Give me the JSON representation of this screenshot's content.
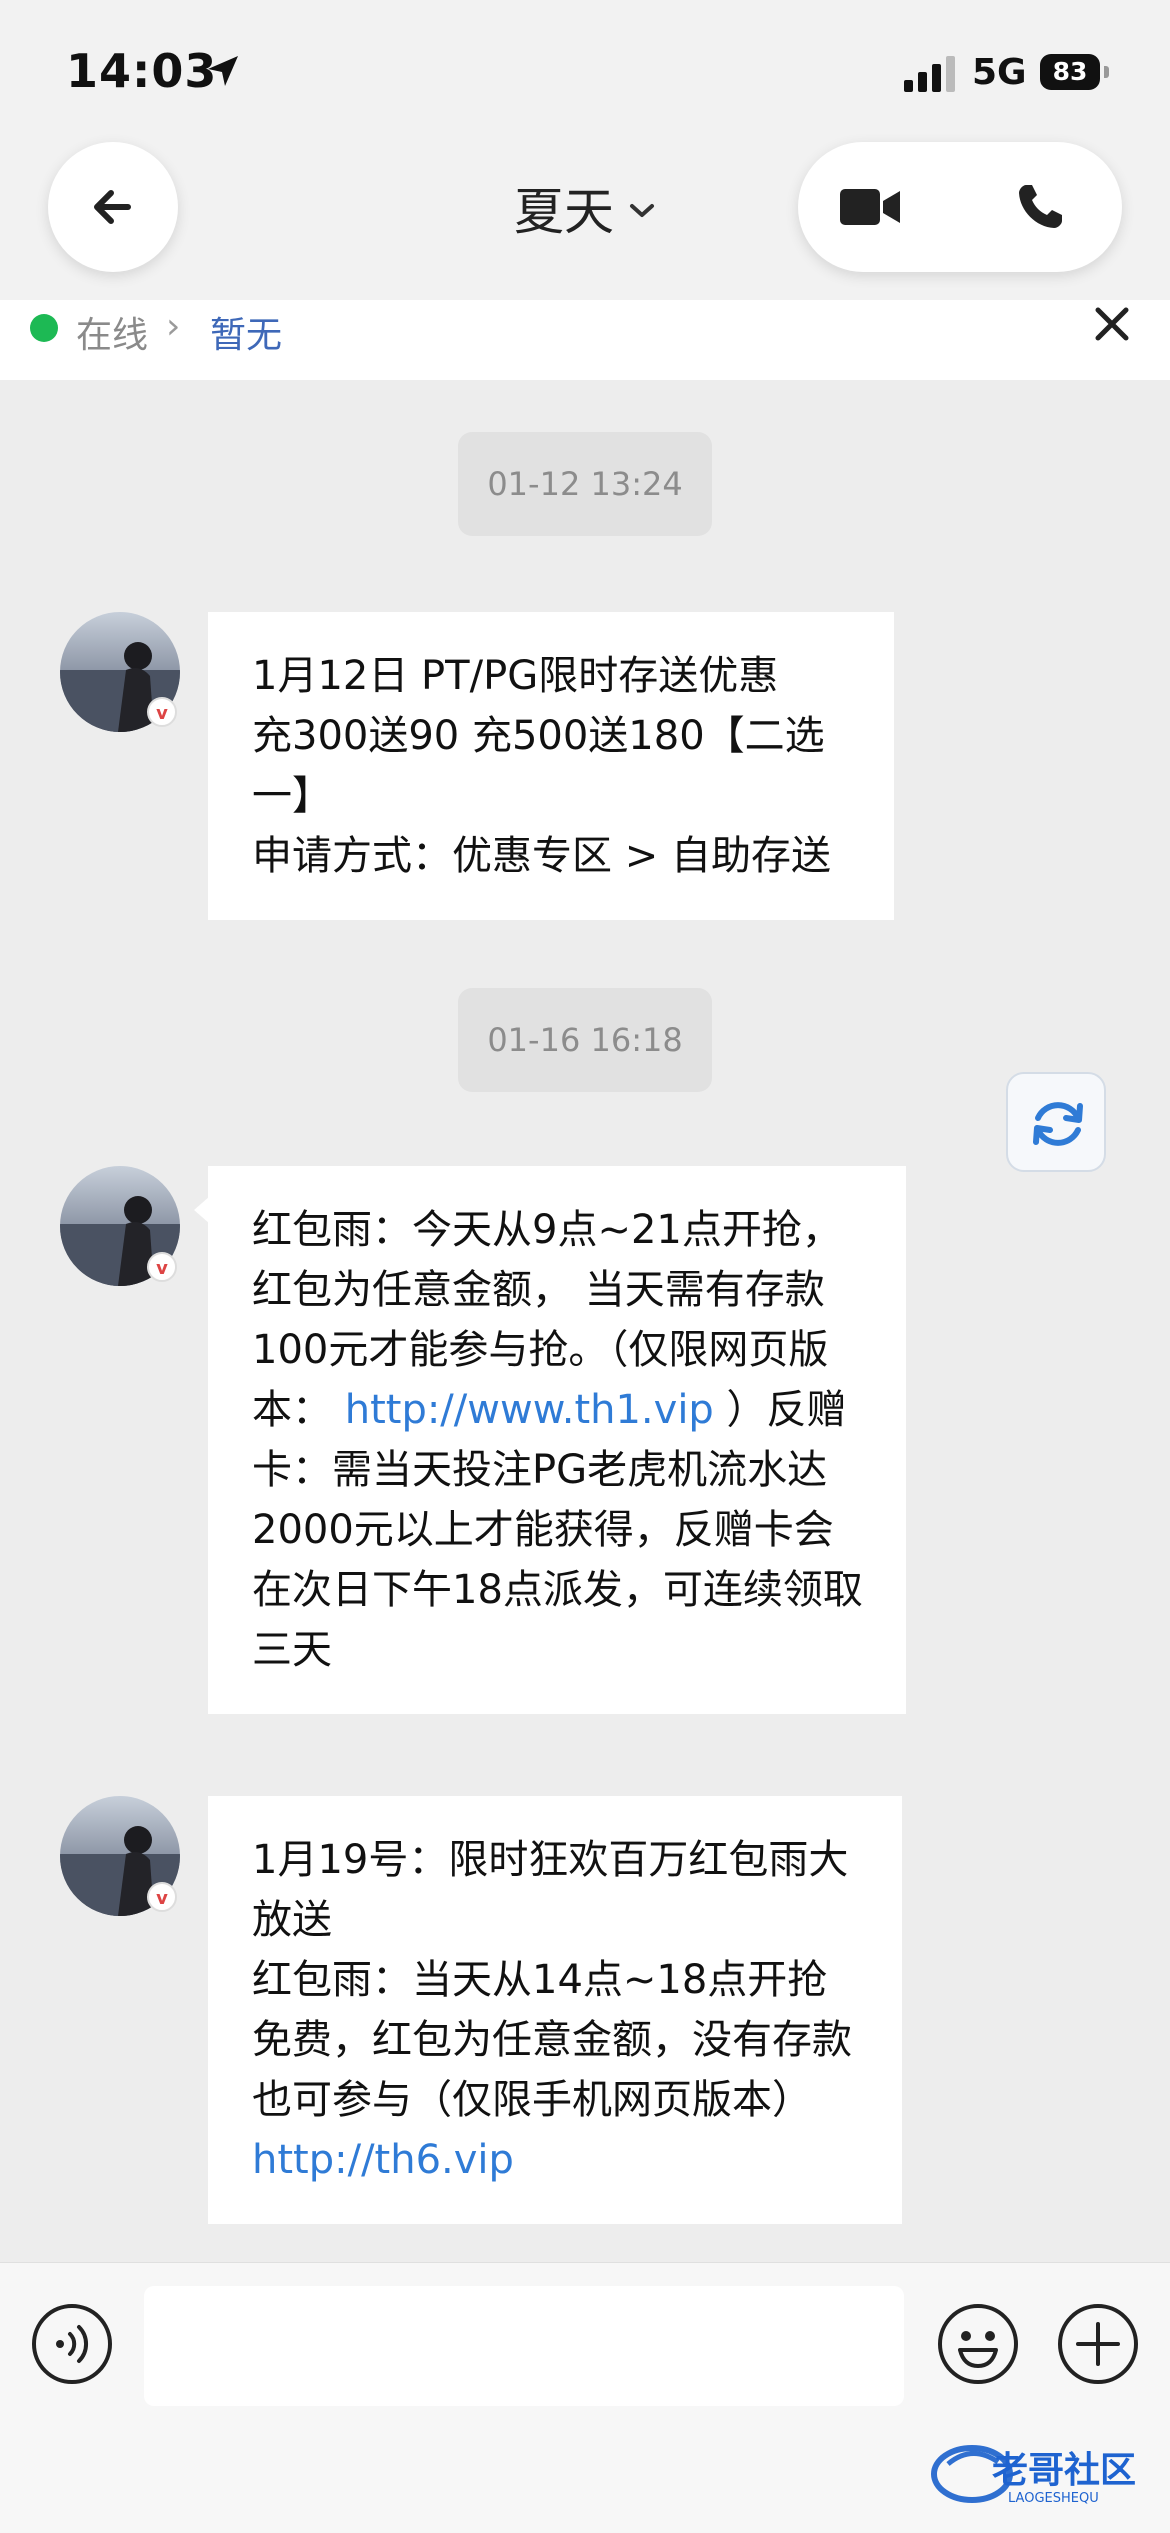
{
  "status_bar": {
    "time": "14:03",
    "network": "5G",
    "battery": "83"
  },
  "header": {
    "contact_name": "夏天"
  },
  "online_bar": {
    "status": "在线",
    "separator": "›",
    "link_text": "暂无"
  },
  "messages": [
    {
      "timestamp": "01-12 13:24",
      "lines": [
        "1月12日 PT/PG限时存送优惠",
        "充300送90   充500送180【二选一】",
        "申请方式：优惠专区 > 自助存送"
      ]
    },
    {
      "timestamp": "01-16 16:18",
      "part1": "红包雨：今天从9点~21点开抢，红包为任意金额， 当天需有存款100元才能参与抢。（仅限网页版本：  ",
      "link": "http://www.th1.vip",
      "part2": "  ）反赠卡：需当天投注PG老虎机流水达2000元以上才能获得，反赠卡会在次日下午18点派发，可连续领取三天"
    },
    {
      "lines": [
        "1月19号：限时狂欢百万红包雨大放送",
        "红包雨：当天从14点~18点开抢免费，红包为任意金额，没有存款也可参与（仅限手机网页版本）"
      ],
      "link": "http://th6.vip"
    }
  ],
  "avatar_badge": "v",
  "watermark": {
    "text": "老哥社区",
    "subtext": "LAOGESHEQU"
  },
  "colors": {
    "online": "#1db954",
    "link": "#2f7bd6",
    "background": "#ededed"
  },
  "icons": [
    "back-arrow-icon",
    "chevron-down-icon",
    "video-camera-icon",
    "phone-icon",
    "close-icon",
    "refresh-icon",
    "voice-icon",
    "emoji-icon",
    "plus-icon"
  ]
}
